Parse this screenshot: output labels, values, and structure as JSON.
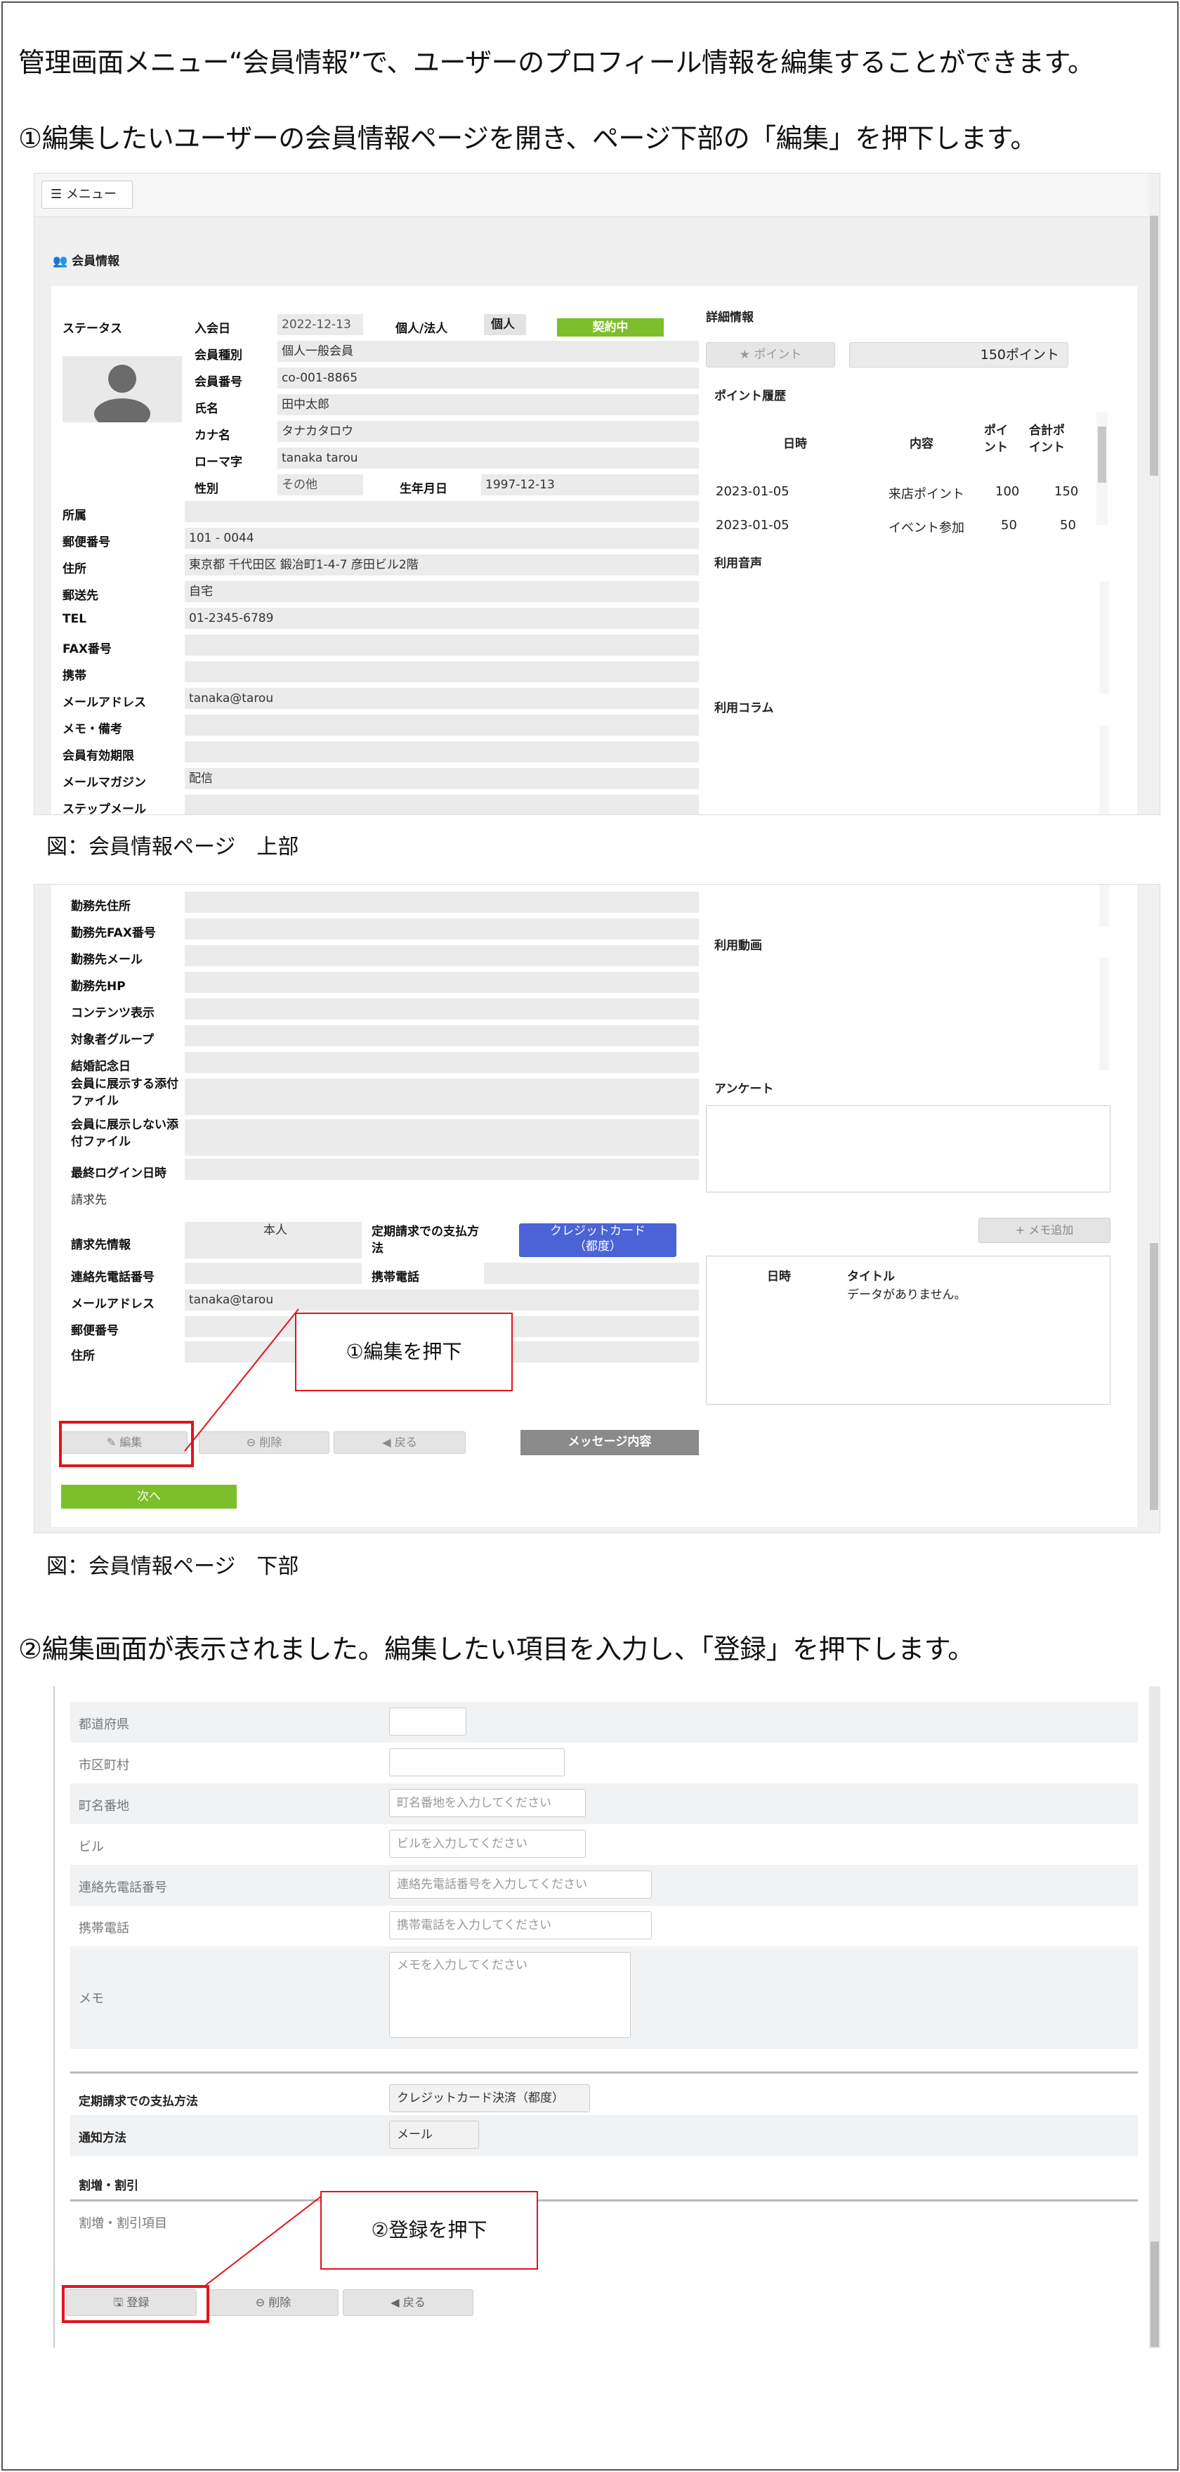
{
  "intro": "管理画面メニュー“会員情報”で、ユーザーのプロフィール情報を編集することができます。",
  "step1": "①編集したいユーザーの会員情報ページを開き、ページ下部の「編集」を押下します。",
  "step2": "②編集画面が表示されました。編集したい項目を入力し、「登録」を押下します。",
  "caption_top": "図：会員情報ページ　上部",
  "caption_bottom": "図：会員情報ページ　下部",
  "shot1": {
    "menu_button": "メニュー",
    "section_title": "会員情報",
    "status_label": "ステータス",
    "join_date_label": "入会日",
    "join_date": "2022-12-13",
    "person_type_label": "個人/法人",
    "person_type": "個人",
    "contract_badge": "契約中",
    "fields": [
      {
        "label": "会員種別",
        "value": "個人一般会員"
      },
      {
        "label": "会員番号",
        "value": "co-001-8865"
      },
      {
        "label": "氏名",
        "value": "田中太郎"
      },
      {
        "label": "カナ名",
        "value": "タナカタロウ"
      },
      {
        "label": "ローマ字",
        "value": "tanaka tarou"
      }
    ],
    "gender_label": "性別",
    "gender": "その他",
    "birthday_label": "生年月日",
    "birthday": "1997-12-13",
    "long_fields": [
      {
        "label": "所属",
        "value": ""
      },
      {
        "label": "郵便番号",
        "value": "101 - 0044"
      },
      {
        "label": "住所",
        "value": "東京都 千代田区 鍛冶町1-4-7 彦田ビル2階"
      },
      {
        "label": "郵送先",
        "value": "自宅"
      },
      {
        "label": "TEL",
        "value": "01-2345-6789"
      },
      {
        "label": "FAX番号",
        "value": ""
      },
      {
        "label": "携帯",
        "value": ""
      },
      {
        "label": "メールアドレス",
        "value": "tanaka@tarou"
      },
      {
        "label": "メモ・備考",
        "value": ""
      },
      {
        "label": "会員有効期限",
        "value": ""
      },
      {
        "label": "メールマガジン",
        "value": "配信"
      },
      {
        "label": "ステップメール",
        "value": ""
      }
    ],
    "detail_title": "詳細情報",
    "point_button": "ポイント",
    "point_total": "150ポイント",
    "point_history_title": "ポイント履歴",
    "point_headers": [
      "日時",
      "内容",
      "ポイ\nント",
      "合計ポ\nイント"
    ],
    "point_rows": [
      {
        "date": "2023-01-05",
        "content": "来店ポイント",
        "point": "100",
        "total": "150"
      },
      {
        "date": "2023-01-05",
        "content": "イベント参加",
        "point": "50",
        "total": "50"
      }
    ],
    "audio_title": "利用音声",
    "column_title": "利用コラム"
  },
  "shot2": {
    "fields": [
      {
        "label": "勤務先住所",
        "value": ""
      },
      {
        "label": "勤務先FAX番号",
        "value": ""
      },
      {
        "label": "勤務先メール",
        "value": ""
      },
      {
        "label": "勤務先HP",
        "value": ""
      },
      {
        "label": "コンテンツ表示",
        "value": ""
      },
      {
        "label": "対象者グループ",
        "value": ""
      },
      {
        "label": "結婚記念日",
        "value": ""
      }
    ],
    "attach_show": "会員に展示する添付\nファイル",
    "attach_hide": "会員に展示しない添\n付ファイル",
    "last_login": "最終ログイン日時",
    "billing_title": "請求先",
    "billing_info_label": "請求先情報",
    "billing_info": "本人",
    "payment_label": "定期請求での支払方\n法",
    "payment_value": "クレジットカード\n（都度）",
    "contact_tel_label": "連絡先電話番号",
    "mobile_label": "携帯電話",
    "email_label": "メールアドレス",
    "email_value": "tanaka@tarou",
    "zip_label": "郵便番号",
    "address_label": "住所",
    "video_title": "利用動画",
    "survey_title": "アンケート",
    "memo_add_button": "メモ追加",
    "memo_date_header": "日時",
    "memo_title_header": "タイトル",
    "memo_empty": "データがありません。",
    "edit_button": "編集",
    "delete_button": "削除",
    "back_button": "戻る",
    "message_button": "メッセージ内容",
    "next_button": "次へ",
    "callout": "①編集を押下"
  },
  "shot3": {
    "rows": [
      {
        "label": "都道府県",
        "placeholder": ""
      },
      {
        "label": "市区町村",
        "placeholder": ""
      },
      {
        "label": "町名番地",
        "placeholder": "町名番地を入力してください"
      },
      {
        "label": "ビル",
        "placeholder": "ビルを入力してください"
      },
      {
        "label": "連絡先電話番号",
        "placeholder": "連絡先電話番号を入力してください"
      },
      {
        "label": "携帯電話",
        "placeholder": "携帯電話を入力してください"
      }
    ],
    "memo_label": "メモ",
    "memo_placeholder": "メモを入力してください",
    "payment_label": "定期請求での支払方法",
    "payment_value": "クレジットカード決済（都度）",
    "notify_label": "通知方法",
    "notify_value": "メール",
    "discount_title": "割増・割引",
    "discount_item": "割増・割引項目",
    "register_button": "登録",
    "delete_button": "削除",
    "back_button": "戻る",
    "callout": "②登録を押下"
  }
}
